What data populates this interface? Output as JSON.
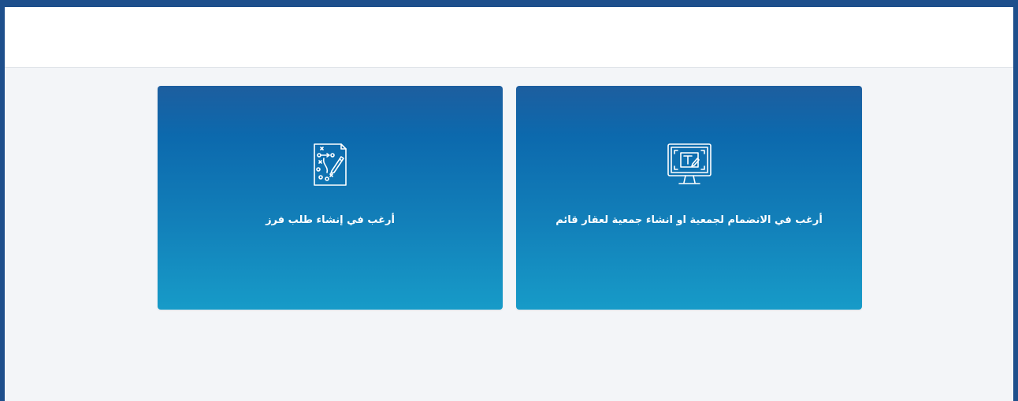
{
  "colors": {
    "frame_border": "#1e4f8c",
    "header_background": "#ffffff",
    "content_background": "#f3f5f8",
    "card_gradient_top": "#1d5e9f",
    "card_gradient_bottom": "#179bc8",
    "card_text": "#ffffff"
  },
  "cards": [
    {
      "label": "أرغب في الانضمام لجمعية او انشاء جمعية لعقار قائم",
      "icon": "monitor-design-icon"
    },
    {
      "label": "أرغب في إنشاء طلب فرز",
      "icon": "strategy-plan-icon"
    }
  ]
}
